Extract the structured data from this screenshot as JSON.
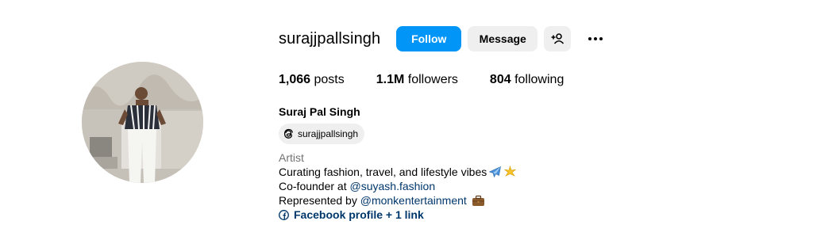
{
  "profile": {
    "username": "surajjpallsingh",
    "buttons": {
      "follow": "Follow",
      "message": "Message",
      "suggest_icon": "person-add-icon",
      "more_icon": "more-options-icon"
    },
    "stats": {
      "posts_count": "1,066",
      "posts_label": "posts",
      "followers_count": "1.1M",
      "followers_label": "followers",
      "following_count": "804",
      "following_label": "following"
    },
    "full_name": "Suraj Pal Singh",
    "threads": {
      "icon": "threads-icon",
      "handle": "surajjpallsingh"
    },
    "bio": {
      "category": "Artist",
      "line1": "Curating fashion, travel, and lifestyle vibes",
      "line1_emojis": [
        "airplane-emoji",
        "sparkle-emoji"
      ],
      "line2_prefix": "Co-founder at ",
      "line2_link": "@suyash.fashion",
      "line3_prefix": "Represented by ",
      "line3_link": "@monkentertainment",
      "line3_emoji": "briefcase-emoji",
      "links_label": "Facebook profile + 1 link",
      "links_icon": "facebook-icon"
    }
  },
  "colors": {
    "follow_bg": "#0095f6",
    "secondary_bg": "#efefef",
    "link": "#00376b",
    "category": "#737373"
  }
}
